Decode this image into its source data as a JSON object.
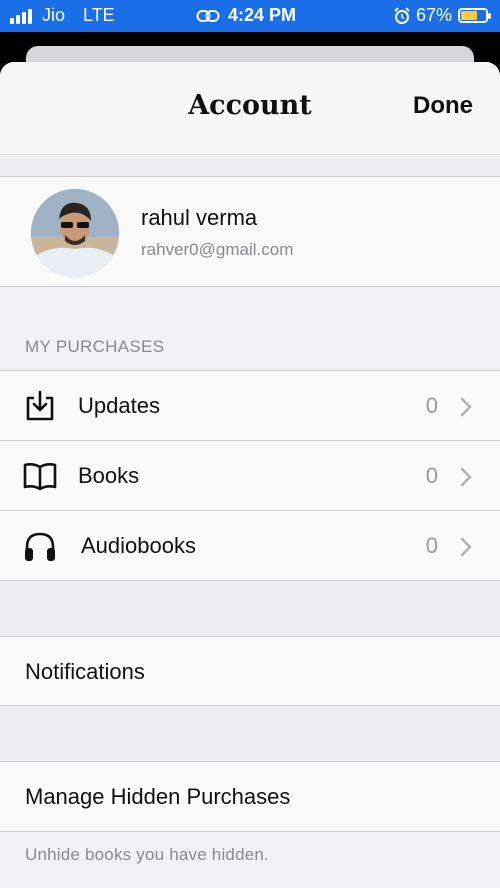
{
  "status_bar": {
    "carrier": "Jio",
    "network": "LTE",
    "time": "4:24 PM",
    "battery": "67%",
    "battery_level": 0.67,
    "icons": [
      "signal-icon",
      "link-icon",
      "alarm-icon",
      "battery-icon"
    ]
  },
  "header": {
    "title": "Account",
    "done_label": "Done"
  },
  "profile": {
    "name": "rahul verma",
    "email": "rahver0@gmail.com"
  },
  "purchases": {
    "section_title": "MY PURCHASES",
    "items": [
      {
        "label": "Updates",
        "count": "0",
        "icon": "download-tray-icon"
      },
      {
        "label": "Books",
        "count": "0",
        "icon": "open-book-icon"
      },
      {
        "label": "Audiobooks",
        "count": "0",
        "icon": "headphones-icon"
      }
    ]
  },
  "notifications": {
    "label": "Notifications"
  },
  "hidden": {
    "label": "Manage Hidden Purchases",
    "footnote": "Unhide books you have hidden."
  },
  "colors": {
    "status_bar": "#1a6fe8",
    "battery_fill": "#ffcc33",
    "sheet_bg": "#f2f2f4",
    "row_bg": "#fafafa",
    "secondary_text": "#8a8a8e"
  }
}
